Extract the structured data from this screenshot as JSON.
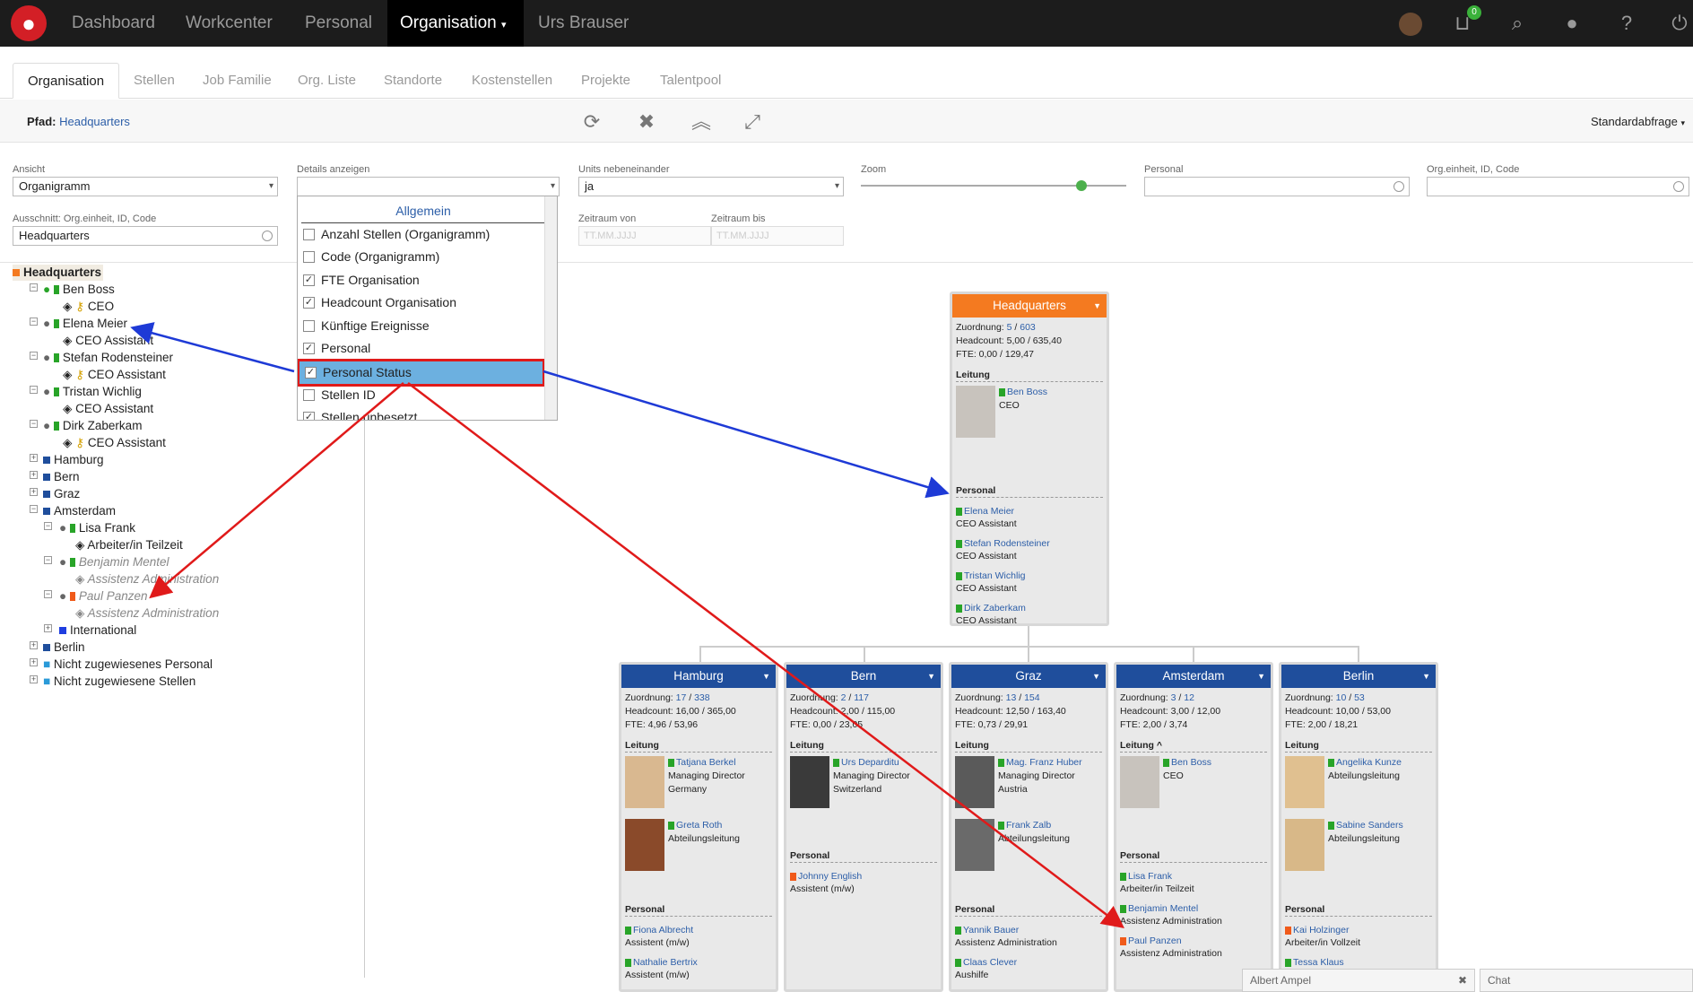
{
  "nav": {
    "items": [
      "Dashboard",
      "Workcenter",
      "Personal"
    ],
    "active": "Organisation",
    "user": "Urs Brauser",
    "cart_count": "0"
  },
  "tabs": [
    "Organisation",
    "Stellen",
    "Job Familie",
    "Org. Liste",
    "Standorte",
    "Kostenstellen",
    "Projekte",
    "Talentpool"
  ],
  "path": {
    "label": "Pfad:",
    "value": "Headquarters",
    "query": "Standardabfrage"
  },
  "filters": {
    "ansicht_label": "Ansicht",
    "ansicht_value": "Organigramm",
    "details_label": "Details anzeigen",
    "details_value": "",
    "units_label": "Units nebeneinander",
    "units_value": "ja",
    "zoom_label": "Zoom",
    "zoom_level": 0.83,
    "personal_label": "Personal",
    "personal_value": "",
    "orgid_label": "Org.einheit, ID, Code",
    "orgid_value": "",
    "ausschnitt_label": "Ausschnitt: Org.einheit, ID, Code",
    "ausschnitt_value": "Headquarters",
    "von_label": "Zeitraum von",
    "von_placeholder": "TT.MM.JJJJ",
    "bis_label": "Zeitraum bis",
    "bis_placeholder": "TT.MM.JJJJ"
  },
  "details_dropdown": {
    "header": "Allgemein",
    "options": [
      {
        "label": "Anzahl Stellen (Organigramm)",
        "checked": false
      },
      {
        "label": "Code (Organigramm)",
        "checked": false
      },
      {
        "label": "FTE Organisation",
        "checked": true
      },
      {
        "label": "Headcount Organisation",
        "checked": true
      },
      {
        "label": "Künftige Ereignisse",
        "checked": false
      },
      {
        "label": "Personal",
        "checked": true
      },
      {
        "label": "Personal Status",
        "checked": true
      },
      {
        "label": "Stellen ID",
        "checked": false
      },
      {
        "label": "Stellen unbesetzt",
        "checked": true
      }
    ]
  },
  "tree": {
    "root": "Headquarters",
    "n1": "Ben Boss",
    "n1r": "CEO",
    "n2": "Elena Meier",
    "n2r": "CEO Assistant",
    "n3": "Stefan Rodensteiner",
    "n3r": "CEO Assistant",
    "n4": "Tristan Wichlig",
    "n4r": "CEO Assistant",
    "n5": "Dirk Zaberkam",
    "n5r": "CEO Assistant",
    "hamburg": "Hamburg",
    "bern": "Bern",
    "graz": "Graz",
    "amsterdam": "Amsterdam",
    "a1": "Lisa Frank",
    "a1r": "Arbeiter/in Teilzeit",
    "a2": "Benjamin Mentel",
    "a2r": "Assistenz Administration",
    "a3": "Paul Panzen",
    "a3r": "Assistenz Administration",
    "international": "International",
    "berlin": "Berlin",
    "unassigned_staff": "Nicht zugewiesenes Personal",
    "unassigned_pos": "Nicht zugewiesene Stellen"
  },
  "hq": {
    "title": "Headquarters",
    "zuordnung_label": "Zuordnung:",
    "zuordnung_a": "5",
    "zuordnung_b": "603",
    "headcount": "Headcount: 5,00 / 635,40",
    "fte": "FTE: 0,00 / 129,47",
    "leitung": "Leitung",
    "lead_name": "Ben Boss",
    "lead_role": "CEO",
    "personal": "Personal",
    "p1": "Elena Meier",
    "p1r": "CEO Assistant",
    "p2": "Stefan Rodensteiner",
    "p2r": "CEO Assistant",
    "p3": "Tristan Wichlig",
    "p3r": "CEO Assistant",
    "p4": "Dirk Zaberkam",
    "p4r": "CEO Assistant"
  },
  "units": [
    {
      "title": "Hamburg",
      "za": "17",
      "zb": "338",
      "hc": "Headcount: 16,00 / 365,00",
      "fte": "FTE: 4,96 / 53,96",
      "l1": "Tatjana Berkel",
      "l1r1": "Managing Director",
      "l1r2": "Germany",
      "l2": "Greta Roth",
      "l2r1": "Abteilungsleitung",
      "p1": "Fiona Albrecht",
      "p1r": "Assistent (m/w)",
      "p2": "Nathalie Bertrix",
      "p2r": "Assistent (m/w)"
    },
    {
      "title": "Bern",
      "za": "2",
      "zb": "117",
      "hc": "Headcount: 2,00 / 115,00",
      "fte": "FTE: 0,00 / 23,05",
      "l1": "Urs Deparditu",
      "l1r1": "Managing Director",
      "l1r2": "Switzerland",
      "p1": "Johnny English",
      "p1r": "Assistent (m/w)"
    },
    {
      "title": "Graz",
      "za": "13",
      "zb": "154",
      "hc": "Headcount: 12,50 / 163,40",
      "fte": "FTE: 0,73 / 29,91",
      "l1": "Mag. Franz Huber",
      "l1r1": "Managing Director",
      "l1r2": "Austria",
      "l2": "Frank Zalb",
      "l2r1": "Abteilungsleitung",
      "p1": "Yannik Bauer",
      "p1r": "Assistenz Administration",
      "p2": "Claas Clever",
      "p2r": "Aushilfe"
    },
    {
      "title": "Amsterdam",
      "za": "3",
      "zb": "12",
      "hc": "Headcount: 3,00 / 12,00",
      "fte": "FTE: 2,00 / 3,74",
      "leitung": "Leitung ^",
      "l1": "Ben Boss",
      "l1r1": "CEO",
      "p1": "Lisa Frank",
      "p1r": "Arbeiter/in Teilzeit",
      "p2": "Benjamin Mentel",
      "p2r": "Assistenz Administration",
      "p3": "Paul Panzen",
      "p3r": "Assistenz Administration"
    },
    {
      "title": "Berlin",
      "za": "10",
      "zb": "53",
      "hc": "Headcount: 10,00 / 53,00",
      "fte": "FTE: 2,00 / 18,21",
      "l1": "Angelika Kunze",
      "l1r1": "Abteilungsleitung",
      "l2": "Sabine Sanders",
      "l2r1": "Abteilungsleitung",
      "p1": "Kai Holzinger",
      "p1r": "Arbeiter/in Vollzeit",
      "p2": "Tessa Klaus",
      "p2r": ""
    }
  ],
  "common": {
    "leitung": "Leitung",
    "personal": "Personal",
    "zuordnung": "Zuordnung:"
  },
  "chat": {
    "ampel": "Albert Ampel",
    "chat": "Chat"
  },
  "colors": {
    "navbar": "#1c1c1c",
    "unit_header": "#1f4e9c",
    "hq_header": "#f47a20",
    "arrow_blue": "#1e3ad6",
    "arrow_red": "#e01a1a"
  }
}
